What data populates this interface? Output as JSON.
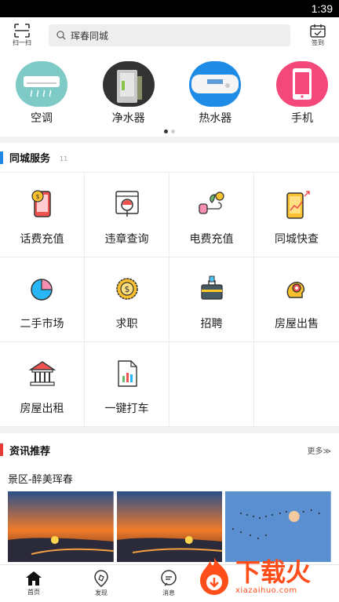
{
  "status": {
    "time": "1:39"
  },
  "header": {
    "scan_label": "扫一扫",
    "search_value": "珲春同城",
    "sign_label": "签到"
  },
  "categories": [
    {
      "label": "空调",
      "icon": "air-conditioner-icon",
      "bg": "#7ecac6"
    },
    {
      "label": "净水器",
      "icon": "water-purifier-icon",
      "bg": "#333333"
    },
    {
      "label": "热水器",
      "icon": "water-heater-icon",
      "bg": "#1e8be6"
    },
    {
      "label": "手机",
      "icon": "phone-icon",
      "bg": "#f4487a"
    }
  ],
  "services": {
    "title": "同城服务",
    "count": "11",
    "items": [
      {
        "label": "话费充值",
        "icon": "phone-recharge-icon"
      },
      {
        "label": "违章查询",
        "icon": "violation-query-icon"
      },
      {
        "label": "电费充值",
        "icon": "electricity-recharge-icon"
      },
      {
        "label": "同城快查",
        "icon": "quick-check-icon"
      },
      {
        "label": "二手市场",
        "icon": "secondhand-market-icon"
      },
      {
        "label": "求职",
        "icon": "job-seeking-icon"
      },
      {
        "label": "招聘",
        "icon": "recruitment-icon"
      },
      {
        "label": "房屋出售",
        "icon": "house-sale-icon"
      },
      {
        "label": "房屋出租",
        "icon": "house-rent-icon"
      },
      {
        "label": "一键打车",
        "icon": "taxi-icon"
      }
    ]
  },
  "news": {
    "title": "资讯推荐",
    "more": "更多≫",
    "article_title": "景区-醉美珲春"
  },
  "tabs": [
    {
      "label": "首页",
      "icon": "home-icon"
    },
    {
      "label": "发现",
      "icon": "discover-icon"
    },
    {
      "label": "消息",
      "icon": "message-icon"
    }
  ],
  "watermark": {
    "big": "下载火",
    "small": "xiazaihuo.com"
  },
  "colors": {
    "accent_blue": "#1e88e5",
    "accent_red": "#e53935",
    "brand_orange": "#ff4e19"
  }
}
